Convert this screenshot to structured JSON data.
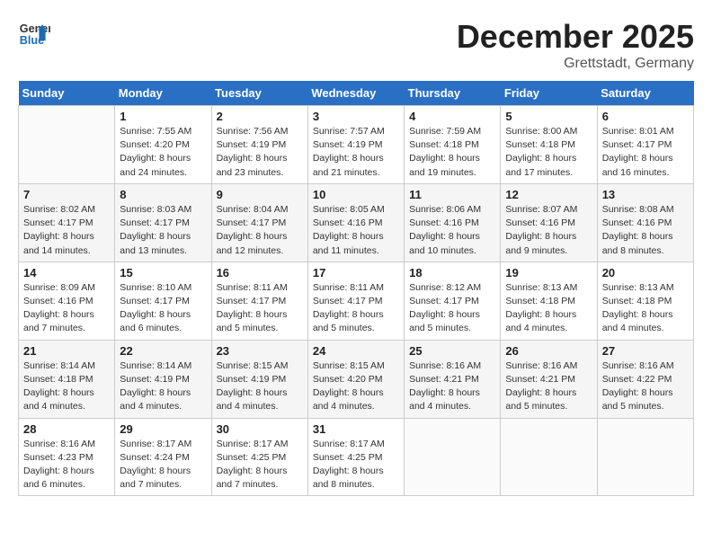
{
  "header": {
    "logo_line1": "General",
    "logo_line2": "Blue",
    "month": "December 2025",
    "location": "Grettstadt, Germany"
  },
  "weekdays": [
    "Sunday",
    "Monday",
    "Tuesday",
    "Wednesday",
    "Thursday",
    "Friday",
    "Saturday"
  ],
  "weeks": [
    [
      {
        "day": "",
        "empty": true
      },
      {
        "day": "1",
        "sunrise": "7:55 AM",
        "sunset": "4:20 PM",
        "daylight": "8 hours and 24 minutes."
      },
      {
        "day": "2",
        "sunrise": "7:56 AM",
        "sunset": "4:19 PM",
        "daylight": "8 hours and 23 minutes."
      },
      {
        "day": "3",
        "sunrise": "7:57 AM",
        "sunset": "4:19 PM",
        "daylight": "8 hours and 21 minutes."
      },
      {
        "day": "4",
        "sunrise": "7:59 AM",
        "sunset": "4:18 PM",
        "daylight": "8 hours and 19 minutes."
      },
      {
        "day": "5",
        "sunrise": "8:00 AM",
        "sunset": "4:18 PM",
        "daylight": "8 hours and 17 minutes."
      },
      {
        "day": "6",
        "sunrise": "8:01 AM",
        "sunset": "4:17 PM",
        "daylight": "8 hours and 16 minutes."
      }
    ],
    [
      {
        "day": "7",
        "sunrise": "8:02 AM",
        "sunset": "4:17 PM",
        "daylight": "8 hours and 14 minutes."
      },
      {
        "day": "8",
        "sunrise": "8:03 AM",
        "sunset": "4:17 PM",
        "daylight": "8 hours and 13 minutes."
      },
      {
        "day": "9",
        "sunrise": "8:04 AM",
        "sunset": "4:17 PM",
        "daylight": "8 hours and 12 minutes."
      },
      {
        "day": "10",
        "sunrise": "8:05 AM",
        "sunset": "4:16 PM",
        "daylight": "8 hours and 11 minutes."
      },
      {
        "day": "11",
        "sunrise": "8:06 AM",
        "sunset": "4:16 PM",
        "daylight": "8 hours and 10 minutes."
      },
      {
        "day": "12",
        "sunrise": "8:07 AM",
        "sunset": "4:16 PM",
        "daylight": "8 hours and 9 minutes."
      },
      {
        "day": "13",
        "sunrise": "8:08 AM",
        "sunset": "4:16 PM",
        "daylight": "8 hours and 8 minutes."
      }
    ],
    [
      {
        "day": "14",
        "sunrise": "8:09 AM",
        "sunset": "4:16 PM",
        "daylight": "8 hours and 7 minutes."
      },
      {
        "day": "15",
        "sunrise": "8:10 AM",
        "sunset": "4:17 PM",
        "daylight": "8 hours and 6 minutes."
      },
      {
        "day": "16",
        "sunrise": "8:11 AM",
        "sunset": "4:17 PM",
        "daylight": "8 hours and 5 minutes."
      },
      {
        "day": "17",
        "sunrise": "8:11 AM",
        "sunset": "4:17 PM",
        "daylight": "8 hours and 5 minutes."
      },
      {
        "day": "18",
        "sunrise": "8:12 AM",
        "sunset": "4:17 PM",
        "daylight": "8 hours and 5 minutes."
      },
      {
        "day": "19",
        "sunrise": "8:13 AM",
        "sunset": "4:18 PM",
        "daylight": "8 hours and 4 minutes."
      },
      {
        "day": "20",
        "sunrise": "8:13 AM",
        "sunset": "4:18 PM",
        "daylight": "8 hours and 4 minutes."
      }
    ],
    [
      {
        "day": "21",
        "sunrise": "8:14 AM",
        "sunset": "4:18 PM",
        "daylight": "8 hours and 4 minutes."
      },
      {
        "day": "22",
        "sunrise": "8:14 AM",
        "sunset": "4:19 PM",
        "daylight": "8 hours and 4 minutes."
      },
      {
        "day": "23",
        "sunrise": "8:15 AM",
        "sunset": "4:19 PM",
        "daylight": "8 hours and 4 minutes."
      },
      {
        "day": "24",
        "sunrise": "8:15 AM",
        "sunset": "4:20 PM",
        "daylight": "8 hours and 4 minutes."
      },
      {
        "day": "25",
        "sunrise": "8:16 AM",
        "sunset": "4:21 PM",
        "daylight": "8 hours and 4 minutes."
      },
      {
        "day": "26",
        "sunrise": "8:16 AM",
        "sunset": "4:21 PM",
        "daylight": "8 hours and 5 minutes."
      },
      {
        "day": "27",
        "sunrise": "8:16 AM",
        "sunset": "4:22 PM",
        "daylight": "8 hours and 5 minutes."
      }
    ],
    [
      {
        "day": "28",
        "sunrise": "8:16 AM",
        "sunset": "4:23 PM",
        "daylight": "8 hours and 6 minutes."
      },
      {
        "day": "29",
        "sunrise": "8:17 AM",
        "sunset": "4:24 PM",
        "daylight": "8 hours and 7 minutes."
      },
      {
        "day": "30",
        "sunrise": "8:17 AM",
        "sunset": "4:25 PM",
        "daylight": "8 hours and 7 minutes."
      },
      {
        "day": "31",
        "sunrise": "8:17 AM",
        "sunset": "4:25 PM",
        "daylight": "8 hours and 8 minutes."
      },
      {
        "day": "",
        "empty": true
      },
      {
        "day": "",
        "empty": true
      },
      {
        "day": "",
        "empty": true
      }
    ]
  ],
  "labels": {
    "sunrise": "Sunrise:",
    "sunset": "Sunset:",
    "daylight": "Daylight:"
  }
}
